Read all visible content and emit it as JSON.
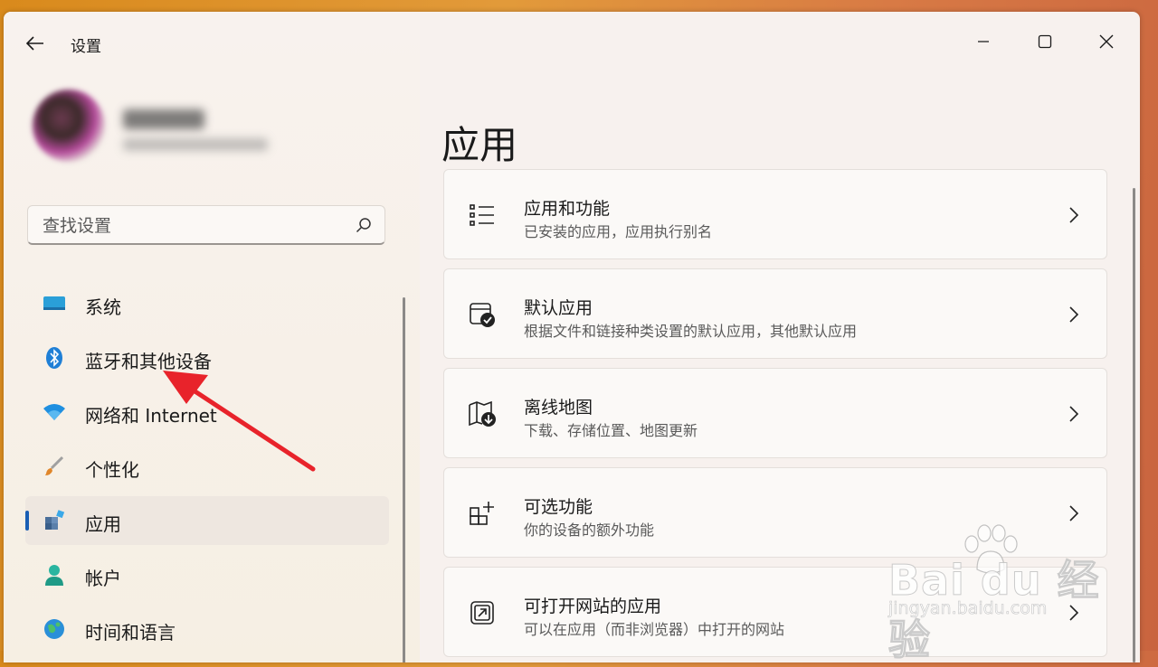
{
  "window": {
    "title": "设置",
    "controls": {
      "minimize": "minimize-icon",
      "maximize": "maximize-icon",
      "close": "close-icon"
    }
  },
  "search": {
    "placeholder": "查找设置"
  },
  "sidebar": {
    "items": [
      {
        "label": "系统",
        "icon": "system-icon"
      },
      {
        "label": "蓝牙和其他设备",
        "icon": "bluetooth-icon"
      },
      {
        "label": "网络和 Internet",
        "icon": "wifi-icon"
      },
      {
        "label": "个性化",
        "icon": "brush-icon"
      },
      {
        "label": "应用",
        "icon": "apps-icon",
        "active": true
      },
      {
        "label": "帐户",
        "icon": "account-icon"
      },
      {
        "label": "时间和语言",
        "icon": "globe-icon"
      }
    ]
  },
  "main": {
    "title": "应用",
    "cards": [
      {
        "title": "应用和功能",
        "subtitle": "已安装的应用，应用执行别名",
        "icon": "list-icon"
      },
      {
        "title": "默认应用",
        "subtitle": "根据文件和链接种类设置的默认应用，其他默认应用",
        "icon": "default-app-icon"
      },
      {
        "title": "离线地图",
        "subtitle": "下载、存储位置、地图更新",
        "icon": "map-download-icon"
      },
      {
        "title": "可选功能",
        "subtitle": "你的设备的额外功能",
        "icon": "add-feature-icon"
      },
      {
        "title": "可打开网站的应用",
        "subtitle": "可以在应用（而非浏览器）中打开的网站",
        "icon": "open-link-icon"
      }
    ]
  },
  "watermark": {
    "main": "Bai du 经验",
    "sub": "jingyan.baidu.com"
  },
  "colors": {
    "accent": "#1a5fb4",
    "annotation_arrow": "#e8232b"
  }
}
